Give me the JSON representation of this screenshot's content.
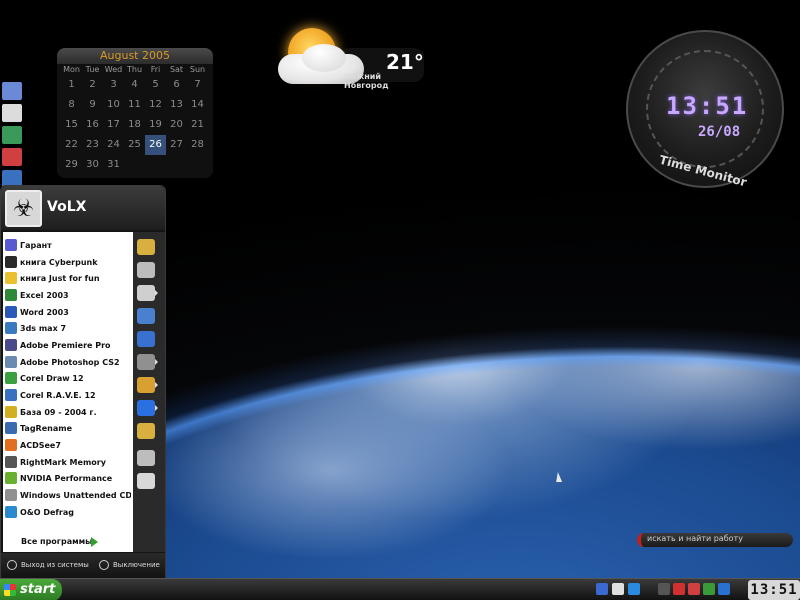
{
  "calendar": {
    "title": "August 2005",
    "weekdays": [
      "Mon",
      "Tue",
      "Wed",
      "Thu",
      "Fri",
      "Sat",
      "Sun"
    ],
    "weeks": [
      [
        "1",
        "2",
        "3",
        "4",
        "5",
        "6",
        "7"
      ],
      [
        "8",
        "9",
        "10",
        "11",
        "12",
        "13",
        "14"
      ],
      [
        "15",
        "16",
        "17",
        "18",
        "19",
        "20",
        "21"
      ],
      [
        "22",
        "23",
        "24",
        "25",
        "26",
        "27",
        "28"
      ],
      [
        "29",
        "30",
        "31",
        "",
        "",
        "",
        ""
      ]
    ],
    "today": "26"
  },
  "weather": {
    "temp": "21°",
    "city": "Нижний Новгород"
  },
  "clock_gadget": {
    "time": "13:51",
    "date": "26/08",
    "label": "Time Monitor"
  },
  "start_menu": {
    "user": "VoLX",
    "programs": [
      {
        "label": "Гарант",
        "icon": "garant-icon",
        "color": "#5a5ad0"
      },
      {
        "label": "книга Cyberpunk",
        "icon": "book-icon",
        "color": "#2a2a2a"
      },
      {
        "label": "книга Just for fun",
        "icon": "tux-icon",
        "color": "#e8c030"
      },
      {
        "label": "Excel 2003",
        "icon": "excel-icon",
        "color": "#2e8a3a"
      },
      {
        "label": "Word 2003",
        "icon": "word-icon",
        "color": "#2a5ab8"
      },
      {
        "label": "3ds max 7",
        "icon": "3dsmax-icon",
        "color": "#3a7ac0"
      },
      {
        "label": "Adobe Premiere Pro",
        "icon": "premiere-icon",
        "color": "#4a4a8a"
      },
      {
        "label": "Adobe Photoshop CS2",
        "icon": "photoshop-icon",
        "color": "#6a8ab0"
      },
      {
        "label": "Corel Draw 12",
        "icon": "coreldraw-icon",
        "color": "#3aa040"
      },
      {
        "label": "Corel R.A.V.E. 12",
        "icon": "corelrave-icon",
        "color": "#3a70c0"
      },
      {
        "label": "База 09 - 2004 г.",
        "icon": "database-icon",
        "color": "#d0b020"
      },
      {
        "label": "TagRename",
        "icon": "tagrename-icon",
        "color": "#3a6ab0"
      },
      {
        "label": "ACDSee7",
        "icon": "acdsee-icon",
        "color": "#e07020"
      },
      {
        "label": "RightMark Memory",
        "icon": "rightmark-icon",
        "color": "#555555"
      },
      {
        "label": "NVIDIA Performance",
        "icon": "nvidia-icon",
        "color": "#6ab030"
      },
      {
        "label": "Windows Unattended CD ...",
        "icon": "windows-cd-icon",
        "color": "#909090"
      },
      {
        "label": "O&O Defrag",
        "icon": "defrag-icon",
        "color": "#2a8ad0"
      }
    ],
    "all_programs": "Все программы",
    "logoff": "Выход из системы",
    "shutdown": "Выключение",
    "right_icons": [
      "my-documents-icon",
      "my-music-icon",
      "favorites-icon",
      "network-icon",
      "internet-icon",
      "control-panel-icon",
      "programs-icon",
      "ie-icon",
      "folders-icon",
      "search-icon",
      "run-icon"
    ]
  },
  "search": {
    "placeholder": "искать и найти работу"
  },
  "taskbar": {
    "start_label": "start",
    "clock": "13:51",
    "colors": {
      "start_green": "#3a9a2e",
      "search_accent": "#c02020"
    }
  }
}
